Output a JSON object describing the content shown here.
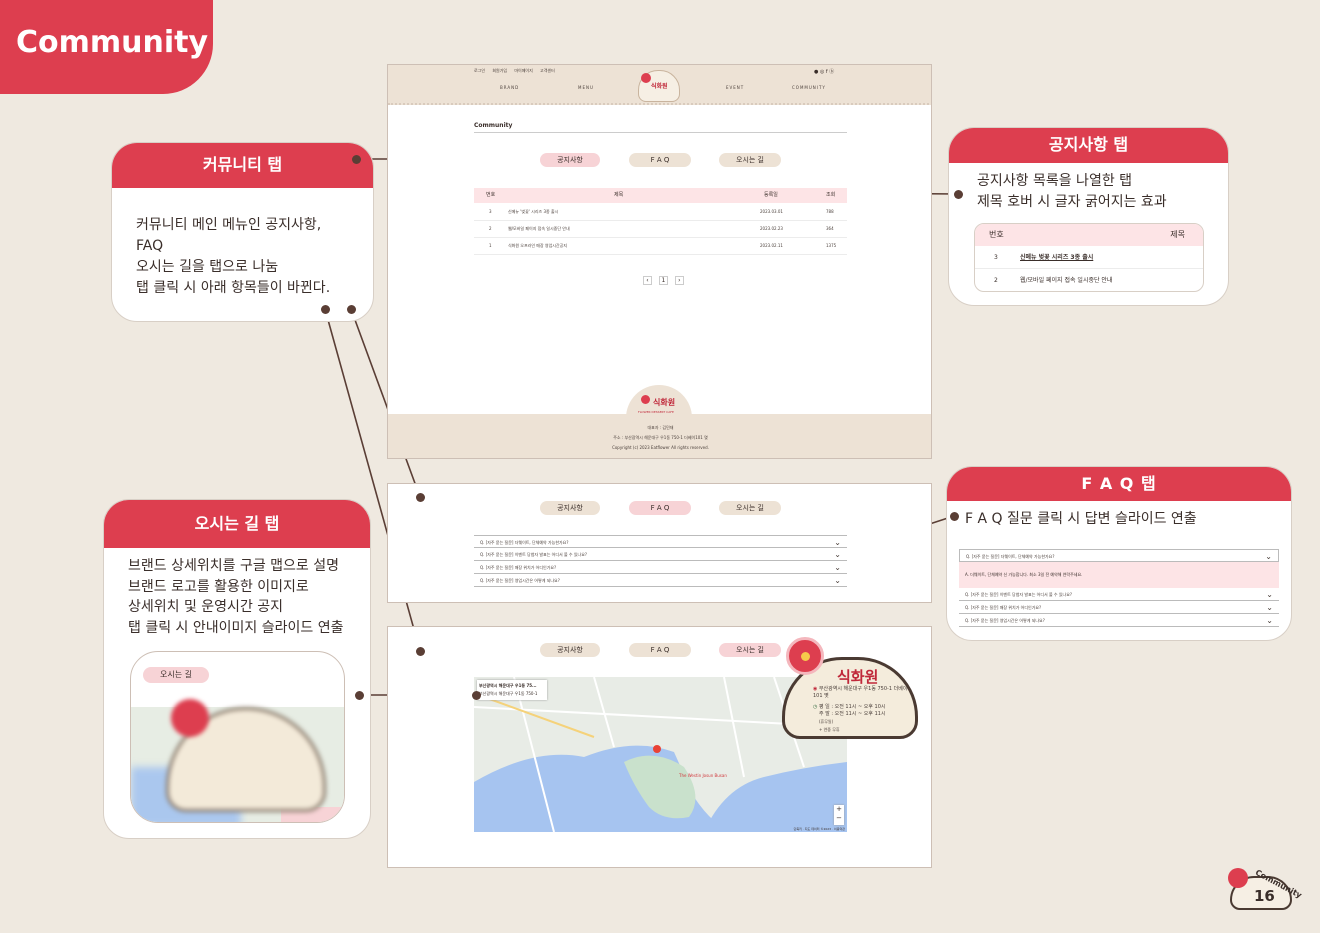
{
  "page_title": "Community",
  "page_number": "16",
  "stamp_text": "Community",
  "colors": {
    "accent": "#dd3e4f",
    "background": "#efe9e0",
    "tab_active": "#f7d3d6",
    "tab_idle": "#ede2d5"
  },
  "callouts": {
    "community_tab": {
      "title": "커뮤니티 탭",
      "lines": [
        "커뮤니티 메인 메뉴인 공지사항, FAQ",
        "오시는 길을 탭으로 나눔",
        "탭 클릭 시 아래 항목들이 바뀐다."
      ]
    },
    "notice_tab": {
      "title": "공지사항 탭",
      "lines": [
        "공지사항 목록을 나열한 탭",
        "제목 호버 시 글자 굵어지는 효과"
      ],
      "preview_headers": [
        "번호",
        "제목"
      ],
      "preview_rows": [
        {
          "no": "3",
          "title": "신메뉴 벚꽃 시리즈 3종 출시"
        },
        {
          "no": "2",
          "title": "웹/모바일 페이지 접속 일시중단 안내"
        }
      ]
    },
    "faq_tab": {
      "title": "F A Q 탭",
      "lines": [
        "F A Q 질문 클릭 시 답변 슬라이드 연출"
      ],
      "preview_q1": "Q. [자주 묻는 질문] 더웨이트, 단체예약 가능한가요?",
      "preview_a1": "A. 더웨이트, 단체예약 신 가능합니다. 최소 3일 전 예약해 연락주세요.",
      "preview_rest": [
        "Q. [자주 묻는 질문] 이벤트 당첨자 발표는 어디서 볼 수 있나요?",
        "Q. [자주 묻는 질문] 매장 위치가 어디인가요?",
        "Q. [자주 묻는 질문] 영업시간은 어떻게 되나요?"
      ]
    },
    "map_tab": {
      "title": "오시는 길 탭",
      "lines": [
        "브랜드 상세위치를 구글 맵으로 설명",
        "브랜드 로고를 활용한 이미지로",
        "상세위치 및 운영시간 공지",
        "탭 클릭 시 안내이미지 슬라이드 연출"
      ],
      "preview_tab": "오시는 길"
    }
  },
  "site": {
    "top_links": [
      "로그인",
      "회원가입",
      "마이페이지",
      "고객센터"
    ],
    "nav": [
      "BRAND",
      "MENU",
      "EVENT",
      "COMMUNITY"
    ],
    "logo_text": "식화원",
    "logo_sub": "FLOWER DESSERT CAFE",
    "section_title": "Community",
    "tabs": [
      "공지사항",
      "F A Q",
      "오시는 길"
    ],
    "table_headers": [
      "번호",
      "제목",
      "등록일",
      "조회"
    ],
    "table_rows": [
      {
        "no": "3",
        "title": "신메뉴 '벚꽃' 시리즈 3종 출시",
        "date": "2023.03.01",
        "views": "788"
      },
      {
        "no": "2",
        "title": "웹/모바일 페이지 접속 일시중단 안내",
        "date": "2023.02.23",
        "views": "364"
      },
      {
        "no": "1",
        "title": "식화원 오프라인 매장 영업시간공지",
        "date": "2023.02.11",
        "views": "1375"
      }
    ],
    "pagination": [
      "‹",
      "1",
      "›"
    ],
    "footer": {
      "ceo": "대표자 : 김민재",
      "address": "주소 : 부산광역시 해운대구 우1동 750-1 더베이101 몇",
      "copyright": "Copyright (c) 2023 Eatflower All rights reserved."
    },
    "faq_items": [
      "Q. [자주 묻는 질문] 더웨이트, 단체예약 가능한가요?",
      "Q. [자주 묻는 질문] 이벤트 당첨자 발표는 어디서 볼 수 있나요?",
      "Q. [자주 묻는 질문] 매장 위치가 어디인가요?",
      "Q. [자주 묻는 질문] 영업시간은 어떻게 되나요?"
    ],
    "map": {
      "search_label": "부산광역시 해운대구 우1동 75...",
      "sub": "부산광역시 해운대구 우1동 750-1",
      "info_address": "부산광역시 해운대구 우1동 750-1 더베이101 몇",
      "info_hours_weekday": "평 일 : 오전 11시 ~ 오후 10시",
      "info_hours_weekend": "주 말 : 오전 11시 ~ 오후 11시",
      "info_note": "(휴무일)",
      "info_more": "+ 연중 무휴",
      "place": "The Westin Josun Busan",
      "zoom_in": "+",
      "zoom_out": "−",
      "attribution": "단축키 · 지도 데이터 ©2023 · 이용약관"
    }
  }
}
